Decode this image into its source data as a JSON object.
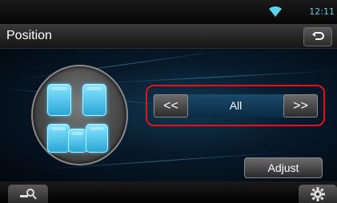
{
  "status": {
    "time": "12:11",
    "wifi_icon": "wifi-icon"
  },
  "header": {
    "title": "Position",
    "back_icon": "back-return-icon"
  },
  "selector": {
    "prev_label": "<<",
    "value": "All",
    "next_label": ">>"
  },
  "adjust_label": "Adjust",
  "footer": {
    "left_icon": "search-settings-icon",
    "right_icon": "gear-icon"
  },
  "colors": {
    "accent": "#5fd1e6",
    "highlight_border": "#e0131e",
    "seat": "#2aa6d6"
  }
}
